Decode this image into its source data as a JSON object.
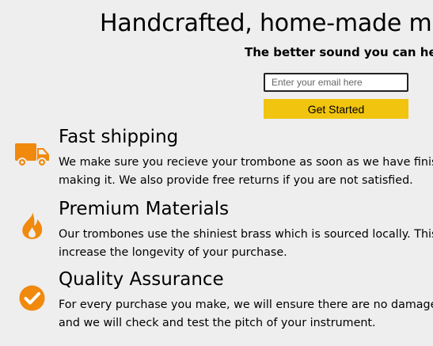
{
  "hero": {
    "title": "Handcrafted, home-made masterpieces",
    "subtitle": "The better sound you can hear",
    "email_placeholder": "Enter your email here",
    "cta_label": "Get Started"
  },
  "colors": {
    "accent": "#f1c40f",
    "icon": "#f1890d",
    "background": "#eeeeee"
  },
  "features": [
    {
      "icon": "truck-icon",
      "title": "Fast shipping",
      "text": "We make sure you recieve your trombone as soon as we have finished making it. We also provide free returns if you are not satisfied."
    },
    {
      "icon": "fire-icon",
      "title": "Premium Materials",
      "text": "Our trombones use the shiniest brass which is sourced locally. This will increase the longevity of your purchase."
    },
    {
      "icon": "check-circle-icon",
      "title": "Quality Assurance",
      "text": "For every purchase you make, we will ensure there are no damages or faults and we will check and test the pitch of your instrument."
    }
  ]
}
